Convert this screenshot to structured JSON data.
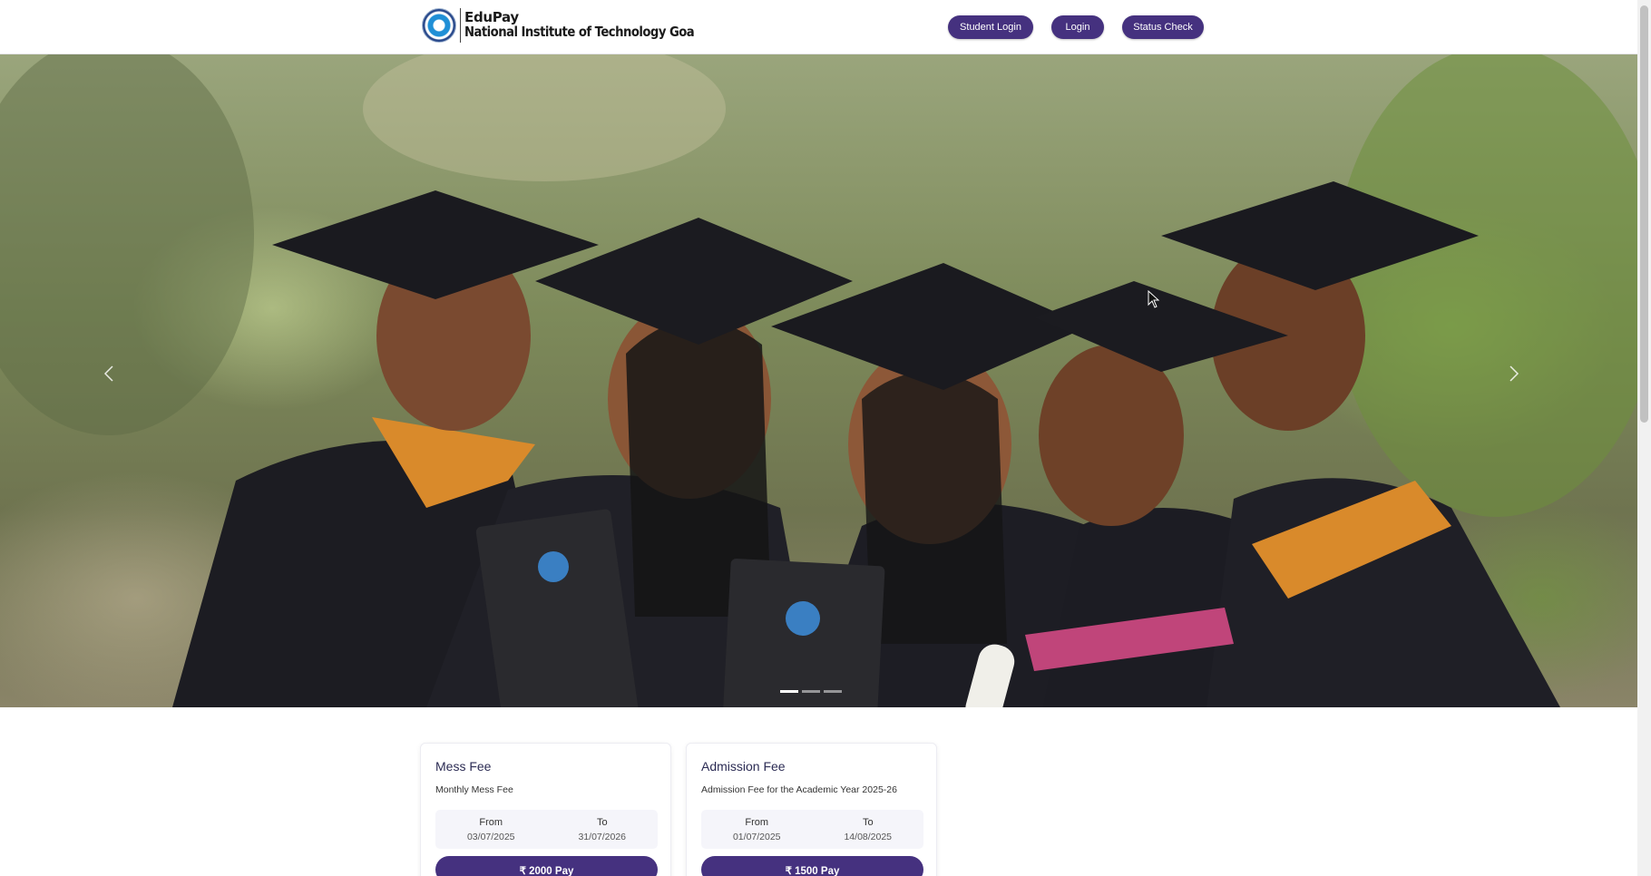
{
  "header": {
    "brand_name": "EduPay",
    "institute_name": "National Institute of Technology Goa",
    "nav": {
      "student_login": "Student Login",
      "login": "Login",
      "status_check": "Status Check"
    }
  },
  "hero": {
    "slides_count": 3,
    "active_slide": 1,
    "prev_icon": "chevron-left-icon",
    "next_icon": "chevron-right-icon"
  },
  "fees": [
    {
      "title": "Mess Fee",
      "description": "Monthly Mess Fee",
      "from_label": "From",
      "from_date": "03/07/2025",
      "to_label": "To",
      "to_date": "31/07/2026",
      "pay_label": "₹ 2000 Pay"
    },
    {
      "title": "Admission Fee",
      "description": "Admission Fee for the Academic Year 2025-26",
      "from_label": "From",
      "from_date": "01/07/2025",
      "to_label": "To",
      "to_date": "14/08/2025",
      "pay_label": "₹ 1500 Pay"
    }
  ],
  "colors": {
    "primary": "#45317f",
    "card_bg": "#ffffff",
    "date_bg": "#f5f5fa"
  }
}
